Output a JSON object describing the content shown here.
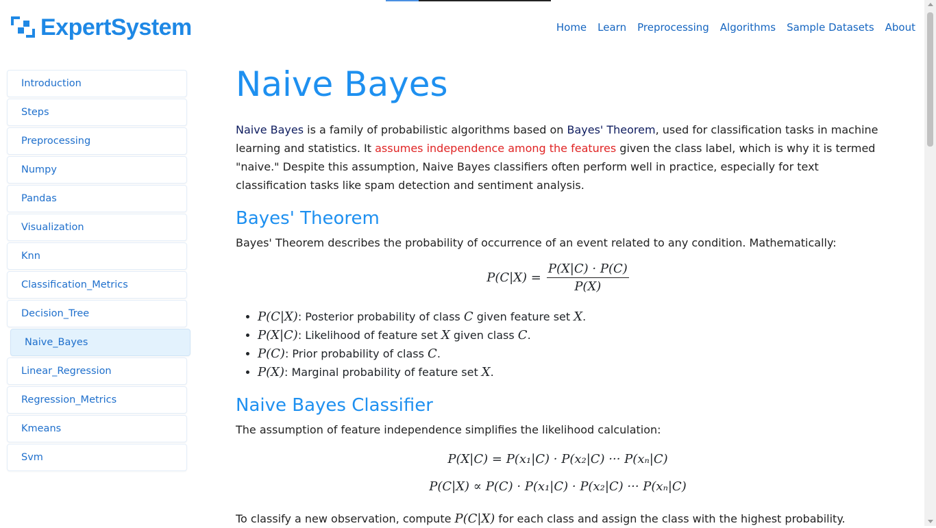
{
  "header": {
    "logo_text": "ExpertSystem",
    "nav": [
      "Home",
      "Learn",
      "Preprocessing",
      "Algorithms",
      "Sample Datasets",
      "About"
    ]
  },
  "reading_progress": 0.2,
  "sidebar": {
    "items": [
      "Introduction",
      "Steps",
      "Preprocessing",
      "Numpy",
      "Pandas",
      "Visualization",
      "Knn",
      "Classification_Metrics",
      "Decision_Tree",
      "Naive_Bayes",
      "Linear_Regression",
      "Regression_Metrics",
      "Kmeans",
      "Svm"
    ],
    "active": "Naive_Bayes"
  },
  "content": {
    "title": "Naive Bayes",
    "intro": {
      "t1": "Naive Bayes",
      "t2": " is a family of probabilistic algorithms based on ",
      "t3": "Bayes' Theorem",
      "t4": ", used for classification tasks in machine learning and statistics. It ",
      "t5": "assumes independence among the features",
      "t6": " given the class label, which is why it is termed \"naive.\" Despite this assumption, Naive Bayes classifiers often perform well in practice, especially for text classification tasks like spam detection and sentiment analysis."
    },
    "bayes": {
      "heading": "Bayes' Theorem",
      "text": "Bayes' Theorem describes the probability of occurrence of an event related to any condition. Mathematically:",
      "lhs": "P(C|X) =",
      "num": "P(X|C) · P(C)",
      "den": "P(X)",
      "bullets": [
        {
          "sym": "P(C|X)",
          "text": ": Posterior probability of class ",
          "v1": "C",
          "mid": " given feature set ",
          "v2": "X",
          "end": "."
        },
        {
          "sym": "P(X|C)",
          "text": ": Likelihood of feature set ",
          "v1": "X",
          "mid": " given class ",
          "v2": "C",
          "end": "."
        },
        {
          "sym": "P(C)",
          "text": ": Prior probability of class ",
          "v1": "C",
          "mid": "",
          "v2": "",
          "end": "."
        },
        {
          "sym": "P(X)",
          "text": ": Marginal probability of feature set ",
          "v1": "X",
          "mid": "",
          "v2": "",
          "end": "."
        }
      ]
    },
    "classifier": {
      "heading": "Naive Bayes Classifier",
      "text": "The assumption of feature independence simplifies the likelihood calculation:",
      "eq1": "P(X|C) = P(x₁|C) · P(x₂|C) ··· P(xₙ|C)",
      "eq2": "P(C|X) ∝ P(C) · P(x₁|C) · P(x₂|C) ··· P(xₙ|C)",
      "tail_a": "To classify a new observation, compute ",
      "tail_sym": "P(C|X)",
      "tail_b": " for each class and assign the class with the highest probability."
    }
  },
  "colors": {
    "accent": "#1e90f0",
    "nav": "#1565c0",
    "emphasis": "#e02424"
  }
}
